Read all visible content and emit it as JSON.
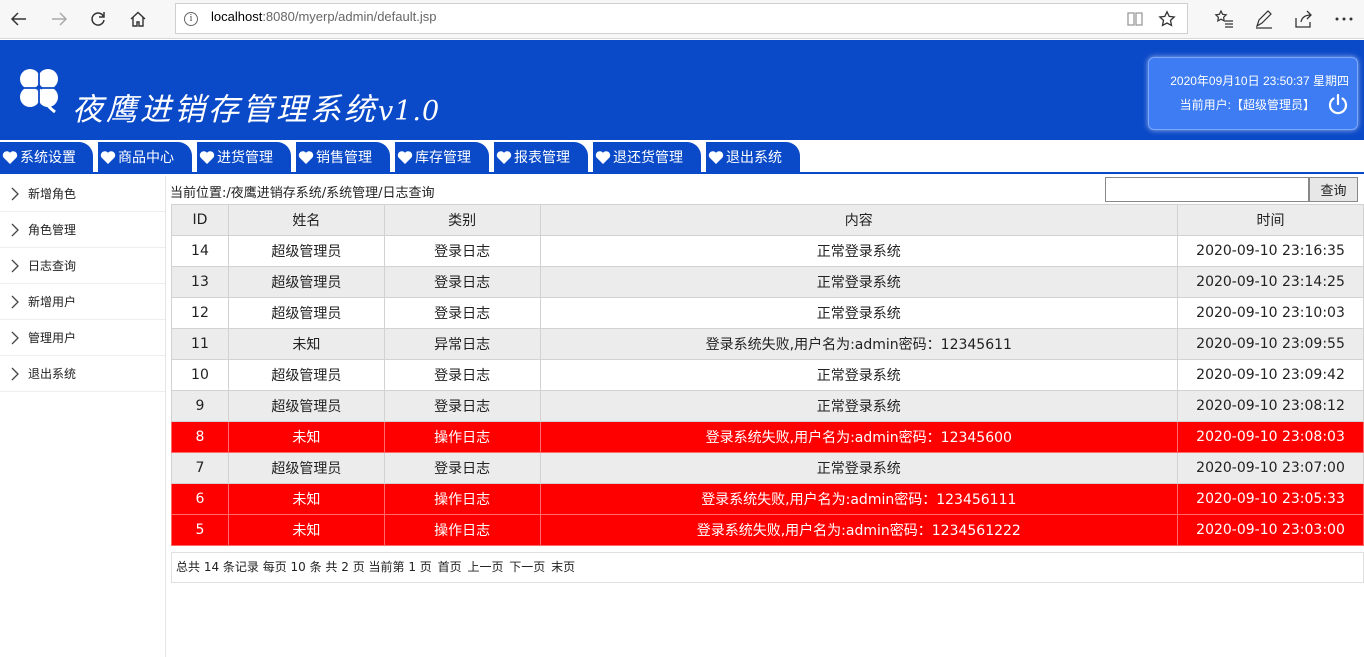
{
  "browser": {
    "url_host": "localhost",
    "url_rest": ":8080/myerp/admin/default.jsp"
  },
  "header": {
    "title": "夜鹰进销存管理系统",
    "version": "v1.0",
    "datetime": "2020年09月10日 23:50:37 星期四",
    "current_user_label": "当前用户:【超级管理员】"
  },
  "tabs": [
    {
      "label": "系统设置"
    },
    {
      "label": "商品中心"
    },
    {
      "label": "进货管理"
    },
    {
      "label": "销售管理"
    },
    {
      "label": "库存管理"
    },
    {
      "label": "报表管理"
    },
    {
      "label": "退还货管理"
    },
    {
      "label": "退出系统"
    }
  ],
  "sidebar": {
    "items": [
      {
        "label": "新增角色"
      },
      {
        "label": "角色管理"
      },
      {
        "label": "日志查询"
      },
      {
        "label": "新增用户"
      },
      {
        "label": "管理用户"
      },
      {
        "label": "退出系统"
      }
    ]
  },
  "breadcrumb": "当前位置:/夜鹰进销存系统/系统管理/日志查询",
  "search": {
    "value": "",
    "button_label": "查询"
  },
  "table": {
    "headers": [
      "ID",
      "姓名",
      "类别",
      "内容",
      "时间"
    ],
    "rows": [
      {
        "id": "14",
        "name": "超级管理员",
        "type": "登录日志",
        "content": "正常登录系统",
        "time": "2020-09-10 23:16:35",
        "style": "normal"
      },
      {
        "id": "13",
        "name": "超级管理员",
        "type": "登录日志",
        "content": "正常登录系统",
        "time": "2020-09-10 23:14:25",
        "style": "alt"
      },
      {
        "id": "12",
        "name": "超级管理员",
        "type": "登录日志",
        "content": "正常登录系统",
        "time": "2020-09-10 23:10:03",
        "style": "normal"
      },
      {
        "id": "11",
        "name": "未知",
        "type": "异常日志",
        "content": "登录系统失败,用户名为:admin密码：12345611",
        "time": "2020-09-10 23:09:55",
        "style": "alt"
      },
      {
        "id": "10",
        "name": "超级管理员",
        "type": "登录日志",
        "content": "正常登录系统",
        "time": "2020-09-10 23:09:42",
        "style": "normal"
      },
      {
        "id": "9",
        "name": "超级管理员",
        "type": "登录日志",
        "content": "正常登录系统",
        "time": "2020-09-10 23:08:12",
        "style": "alt"
      },
      {
        "id": "8",
        "name": "未知",
        "type": "操作日志",
        "content": "登录系统失败,用户名为:admin密码：12345600",
        "time": "2020-09-10 23:08:03",
        "style": "err"
      },
      {
        "id": "7",
        "name": "超级管理员",
        "type": "登录日志",
        "content": "正常登录系统",
        "time": "2020-09-10 23:07:00",
        "style": "alt"
      },
      {
        "id": "6",
        "name": "未知",
        "type": "操作日志",
        "content": "登录系统失败,用户名为:admin密码：123456111",
        "time": "2020-09-10 23:05:33",
        "style": "err"
      },
      {
        "id": "5",
        "name": "未知",
        "type": "操作日志",
        "content": "登录系统失败,用户名为:admin密码：1234561222",
        "time": "2020-09-10 23:03:00",
        "style": "err"
      }
    ]
  },
  "pager": {
    "summary": "总共 14 条记录 每页 10 条 共 2 页 当前第 1 页",
    "first": "首页",
    "prev": "上一页",
    "next": "下一页",
    "last": "末页"
  },
  "colors": {
    "brand_blue": "#0a49c8",
    "error_row": "#ff0000",
    "alt_row": "#ececec"
  }
}
